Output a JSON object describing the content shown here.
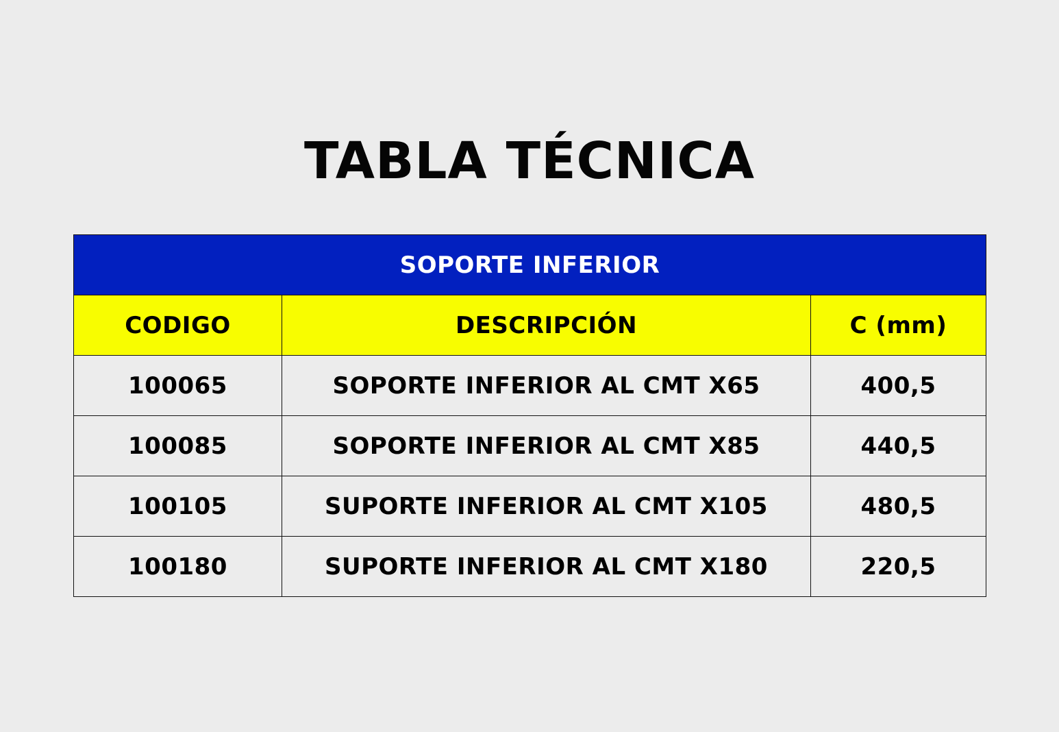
{
  "title": "TABLA TÉCNICA",
  "table": {
    "banner": "SOPORTE INFERIOR",
    "headers": [
      "CODIGO",
      "DESCRIPCIÓN",
      "C (mm)"
    ],
    "rows": [
      [
        "100065",
        "SOPORTE INFERIOR AL CMT X65",
        "400,5"
      ],
      [
        "100085",
        "SOPORTE INFERIOR AL CMT X85",
        "440,5"
      ],
      [
        "100105",
        "SUPORTE INFERIOR AL CMT X105",
        "480,5"
      ],
      [
        "100180",
        "SUPORTE INFERIOR AL CMT X180",
        "220,5"
      ]
    ]
  },
  "colors": {
    "background": "#ececec",
    "banner": "#0220bf",
    "header": "#f8fd00",
    "text": "#000000",
    "banner_text": "#ffffff"
  }
}
